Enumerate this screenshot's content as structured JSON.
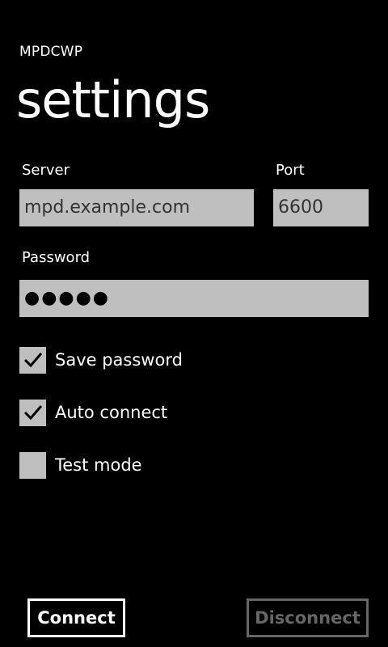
{
  "app": {
    "title": "MPDCWP",
    "page_title": "settings"
  },
  "form": {
    "server_label": "Server",
    "server_value": "mpd.example.com",
    "port_label": "Port",
    "port_value": "6600",
    "password_label": "Password",
    "password_value": "●●●●●"
  },
  "options": [
    {
      "label": "Save password",
      "checked": true
    },
    {
      "label": "Auto connect",
      "checked": true
    },
    {
      "label": "Test mode",
      "checked": false
    }
  ],
  "actions": {
    "connect_label": "Connect",
    "disconnect_label": "Disconnect",
    "disconnect_enabled": false
  },
  "colors": {
    "background": "#000000",
    "foreground": "#ffffff",
    "field_background": "#bfbfbf",
    "field_text": "#333333",
    "disabled": "#666666"
  },
  "icons": {
    "checkmark": "check-icon"
  }
}
